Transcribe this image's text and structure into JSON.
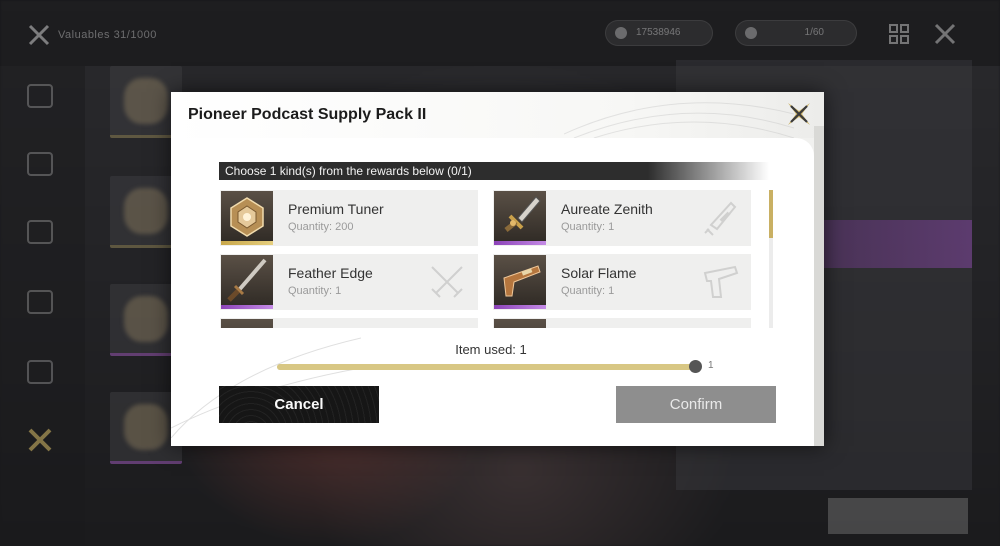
{
  "background": {
    "title_text": "Valuables",
    "title_count": "31/1000",
    "currency_1": "17538946",
    "currency_2": "1/60"
  },
  "dialog": {
    "title": "Pioneer Podcast Supply Pack II",
    "choose_label": "Choose 1 kind(s) from the rewards below (0/1)",
    "items": [
      {
        "name": "Premium Tuner",
        "quantity": "Quantity: 200",
        "rarity": "gold",
        "type_icon": "none"
      },
      {
        "name": "Aureate Zenith",
        "quantity": "Quantity: 1",
        "rarity": "purple",
        "type_icon": "broadblade-icon"
      },
      {
        "name": "Feather Edge",
        "quantity": "Quantity: 1",
        "rarity": "purple",
        "type_icon": "sword-icon"
      },
      {
        "name": "Solar Flame",
        "quantity": "Quantity: 1",
        "rarity": "purple",
        "type_icon": "pistol-icon"
      }
    ],
    "item_used_label": "Item used: 1",
    "slider_value": 1,
    "slider_max_label": "1",
    "slider_fraction": 1.0,
    "cancel_label": "Cancel",
    "confirm_label": "Confirm"
  },
  "colors": {
    "gold_rarity": "#c8a74a",
    "purple_rarity": "#8c43b8",
    "slider_fill": "#d8c784",
    "scroll_thumb": "#c9b063"
  }
}
